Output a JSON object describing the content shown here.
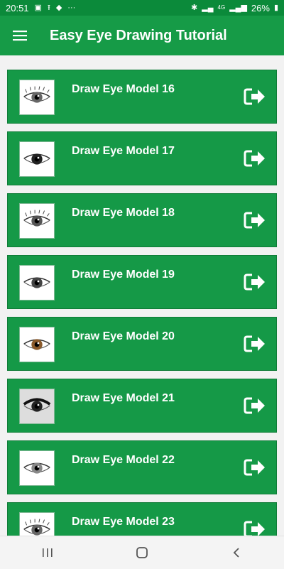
{
  "status_bar": {
    "time": "20:51",
    "battery": "26%",
    "network": "4G"
  },
  "app_bar": {
    "title": "Easy Eye Drawing Tutorial",
    "menu_icon": "hamburger-menu-icon"
  },
  "items": [
    {
      "label": "Draw Eye Model 16",
      "thumb_style": "realistic"
    },
    {
      "label": "Draw Eye Model 17",
      "thumb_style": "anime"
    },
    {
      "label": "Draw Eye Model 18",
      "thumb_style": "lashes"
    },
    {
      "label": "Draw Eye Model 19",
      "thumb_style": "side"
    },
    {
      "label": "Draw Eye Model 20",
      "thumb_style": "brown"
    },
    {
      "label": "Draw Eye Model 21",
      "thumb_style": "dark"
    },
    {
      "label": "Draw Eye Model 22",
      "thumb_style": "sketch"
    },
    {
      "label": "Draw Eye Model 23",
      "thumb_style": "realistic"
    }
  ],
  "item_action_icon": "open-arrow-icon",
  "colors": {
    "primary": "#169b47",
    "primary_dark": "#0b8a3a",
    "card": "#159947",
    "background": "#f2f2f2"
  },
  "nav_bar": {
    "recents_icon": "recents-icon",
    "home_icon": "home-icon",
    "back_icon": "back-icon"
  }
}
